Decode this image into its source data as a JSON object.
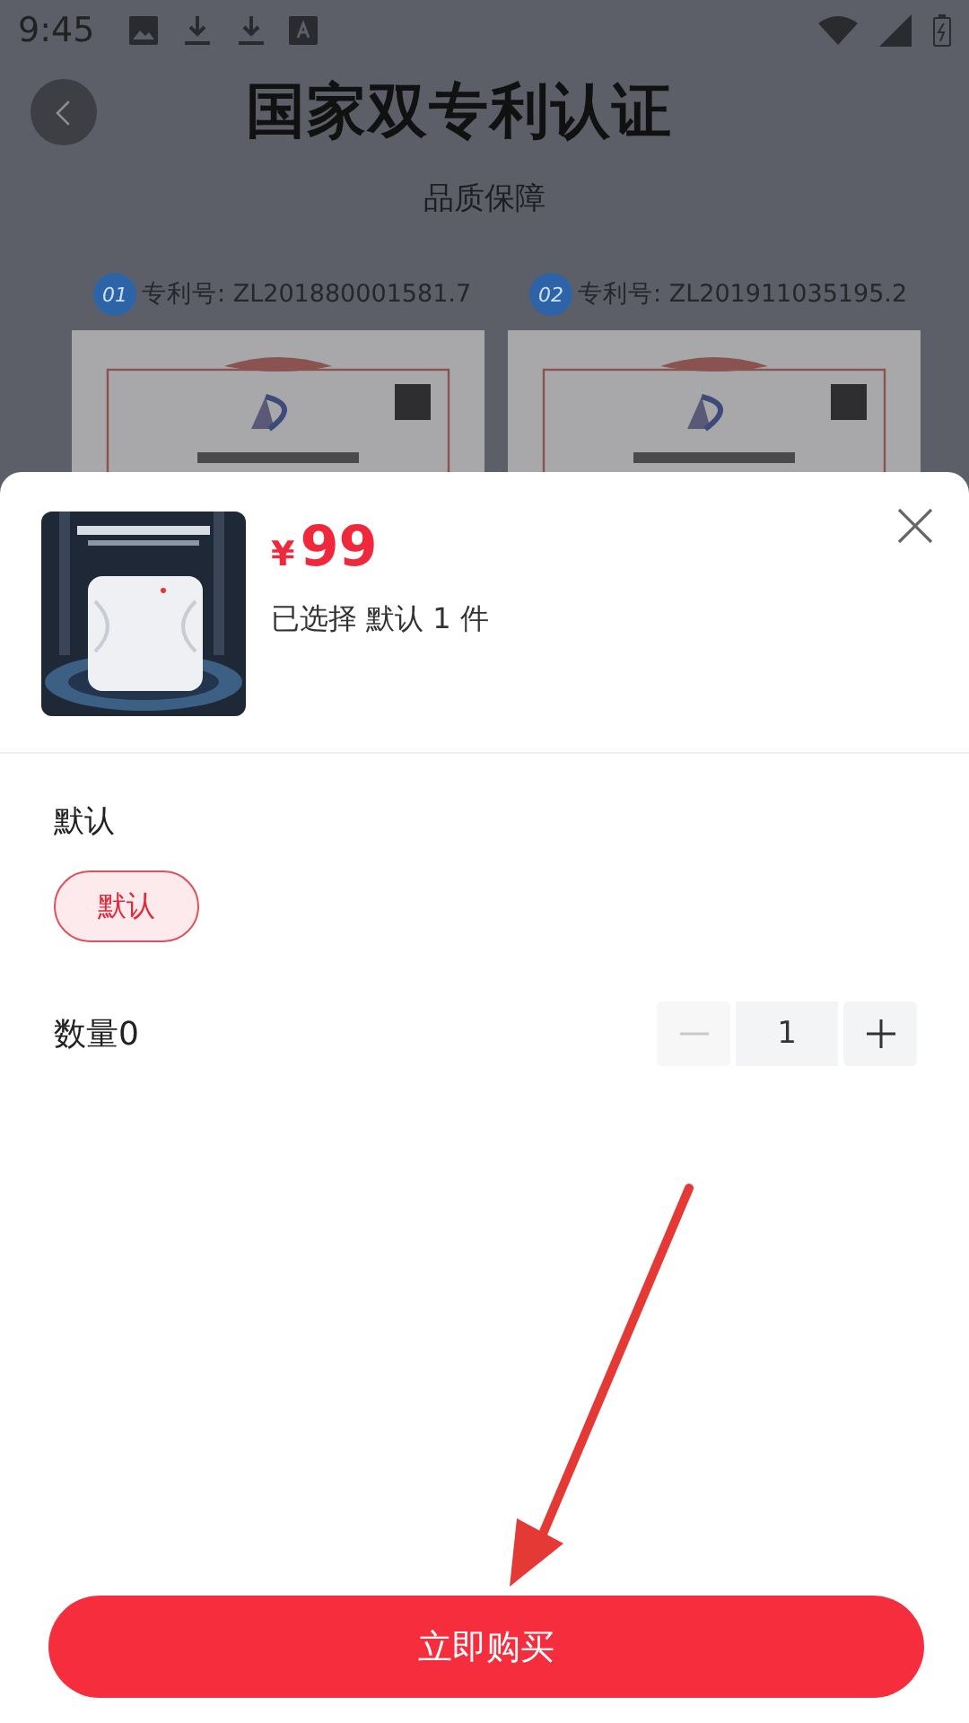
{
  "status_bar": {
    "time": "9:45"
  },
  "page": {
    "title": "国家双专利认证",
    "subtitle": "品质保障",
    "patents": [
      {
        "badge": "01",
        "label": "专利号: ZL201880001581.7"
      },
      {
        "badge": "02",
        "label": "专利号: ZL201911035195.2"
      }
    ]
  },
  "sheet": {
    "price_symbol": "¥",
    "price": "99",
    "selection": "已选择 默认 1 件",
    "spec_title": "默认",
    "options": [
      {
        "label": "默认",
        "selected": true
      }
    ],
    "quantity_label": "数量0",
    "quantity": "1",
    "decrement_disabled": true,
    "buy_button": "立即购买"
  }
}
